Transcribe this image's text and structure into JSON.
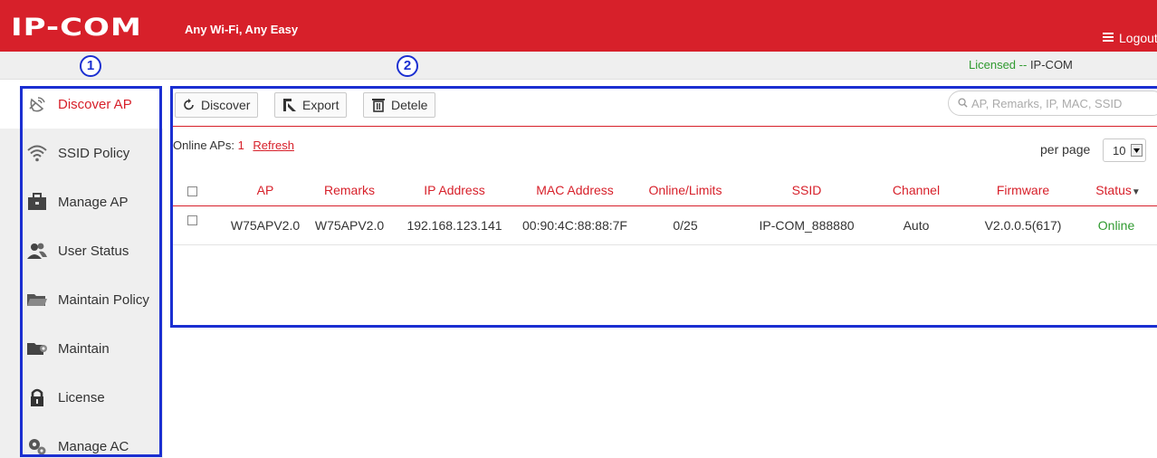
{
  "header": {
    "logo": "IP-COM",
    "slogan": "Any Wi-Fi, Any Easy",
    "logout_label": "Logout",
    "licensed_label": "Licensed --",
    "licensed_name": "IP-COM"
  },
  "callouts": [
    "1",
    "2"
  ],
  "sidebar": {
    "items": [
      {
        "label": "Discover AP",
        "icon": "discover-ap-icon",
        "active": true
      },
      {
        "label": "SSID Policy",
        "icon": "wifi-icon"
      },
      {
        "label": "Manage AP",
        "icon": "briefcase-icon"
      },
      {
        "label": "User Status",
        "icon": "users-icon"
      },
      {
        "label": "Maintain Policy",
        "icon": "folder-icon"
      },
      {
        "label": "Maintain",
        "icon": "folder-gear-icon"
      },
      {
        "label": "License",
        "icon": "lock-icon"
      },
      {
        "label": "Manage AC",
        "icon": "gears-icon"
      }
    ]
  },
  "toolbar": {
    "discover_label": "Discover",
    "export_label": "Export",
    "delete_label": "Detele",
    "search_placeholder": "AP, Remarks, IP, MAC, SSID"
  },
  "summary": {
    "online_label": "Online APs:",
    "online_count": "1",
    "refresh_label": "Refresh",
    "per_page_label": "per page",
    "per_page_value": "10"
  },
  "table": {
    "columns": [
      "AP",
      "Remarks",
      "IP Address",
      "MAC Address",
      "Online/Limits",
      "SSID",
      "Channel",
      "Firmware",
      "Status"
    ],
    "rows": [
      [
        "W75APV2.0",
        "W75APV2.0",
        "192.168.123.141",
        "00:90:4C:88:88:7F",
        "0/25",
        "IP-COM_888880",
        "Auto",
        "V2.0.0.5(617)",
        "Online"
      ]
    ]
  },
  "colors": {
    "brand_red": "#d7202a",
    "annotation_blue": "#1b2fd1",
    "online_green": "#2f9a2f"
  }
}
